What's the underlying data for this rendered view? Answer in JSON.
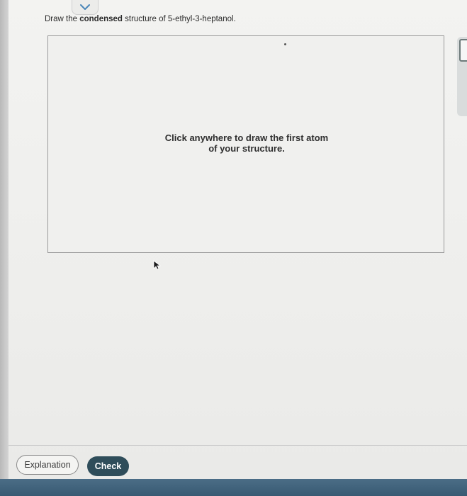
{
  "question": {
    "prefix": "Draw the ",
    "bold": "condensed",
    "suffix": " structure of 5-ethyl-3-heptanol."
  },
  "canvas": {
    "hint_line1": "Click anywhere to draw the first atom",
    "hint_line2": "of your structure."
  },
  "footer": {
    "explanation_label": "Explanation",
    "check_label": "Check"
  },
  "colors": {
    "check_button": "#2f4d5a",
    "toggle_chevron": "#4a86b8",
    "bottom_bar": "#3f627b"
  },
  "icons": {
    "toggle": "chevron-down-icon",
    "pointer": "mouse-cursor-icon"
  }
}
